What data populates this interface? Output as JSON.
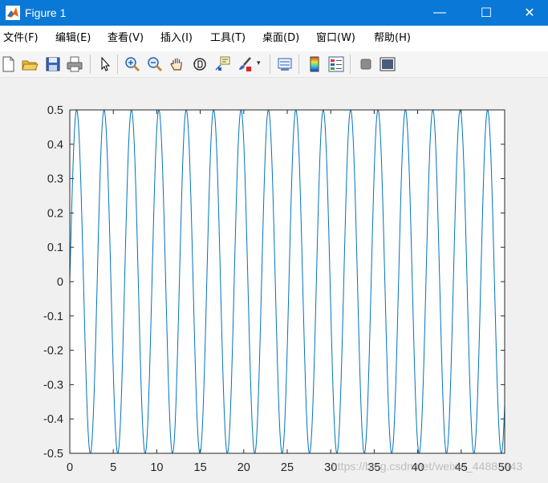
{
  "window": {
    "title": "Figure 1",
    "controls": {
      "minimize": "—",
      "maximize": "☐",
      "close": "✕"
    }
  },
  "menu": {
    "items": [
      {
        "label": "文件(F)"
      },
      {
        "label": "编辑(E)"
      },
      {
        "label": "查看(V)"
      },
      {
        "label": "插入(I)"
      },
      {
        "label": "工具(T)"
      },
      {
        "label": "桌面(D)"
      },
      {
        "label": "窗口(W)"
      },
      {
        "label": "帮助(H)"
      }
    ]
  },
  "toolbar": {
    "buttons": [
      "new-figure-icon",
      "open-file-icon",
      "save-icon",
      "print-icon",
      "pointer-icon",
      "zoom-in-icon",
      "zoom-out-icon",
      "pan-hand-icon",
      "rotate-3d-icon",
      "data-cursor-icon",
      "brush-icon",
      "brush-dropdown-icon",
      "link-plot-icon",
      "colorbar-icon",
      "legend-icon",
      "hide-plot-tools-icon",
      "show-plot-tools-icon"
    ]
  },
  "chart_data": {
    "type": "line",
    "title": "",
    "xlabel": "",
    "ylabel": "",
    "xlim": [
      0,
      50
    ],
    "ylim": [
      -0.5,
      0.5
    ],
    "xticks": [
      "0",
      "5",
      "10",
      "15",
      "20",
      "25",
      "30",
      "35",
      "40",
      "45",
      "50"
    ],
    "yticks": [
      "0.5",
      "0.4",
      "0.3",
      "0.2",
      "0.1",
      "0",
      "-0.1",
      "-0.2",
      "-0.3",
      "-0.4",
      "-0.5"
    ],
    "series": [
      {
        "function": "0.5*sin(2*pi*t/3.15)",
        "x_start": 0,
        "x_end": 50,
        "amplitude": 0.5,
        "period": 3.15
      }
    ],
    "grid": false,
    "line_color": "#0072bd"
  },
  "watermark": "https://blog.csdn.net/weixin_44883643"
}
